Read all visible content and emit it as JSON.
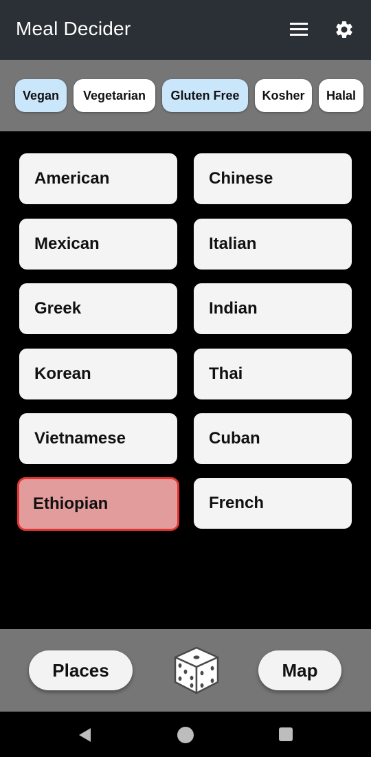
{
  "app": {
    "title": "Meal Decider"
  },
  "filters": [
    {
      "label": "Vegan",
      "selected": true
    },
    {
      "label": "Vegetarian",
      "selected": false
    },
    {
      "label": "Gluten Free",
      "selected": true
    },
    {
      "label": "Kosher",
      "selected": false
    },
    {
      "label": "Halal",
      "selected": false
    }
  ],
  "cuisines": [
    {
      "label": "American",
      "selected": false
    },
    {
      "label": "Chinese",
      "selected": false
    },
    {
      "label": "Mexican",
      "selected": false
    },
    {
      "label": "Italian",
      "selected": false
    },
    {
      "label": "Greek",
      "selected": false
    },
    {
      "label": "Indian",
      "selected": false
    },
    {
      "label": "Korean",
      "selected": false
    },
    {
      "label": "Thai",
      "selected": false
    },
    {
      "label": "Vietnamese",
      "selected": false
    },
    {
      "label": "Cuban",
      "selected": false
    },
    {
      "label": "Ethiopian",
      "selected": true
    },
    {
      "label": "French",
      "selected": false
    }
  ],
  "bottom": {
    "places_label": "Places",
    "map_label": "Map"
  },
  "colors": {
    "appbar": "#2a3036",
    "chip_selected": "#c9e6fb",
    "card_selected_fill": "#e39c9c",
    "card_selected_border": "#e3352f"
  },
  "icons": {
    "menu": "menu-icon",
    "settings": "gear-icon",
    "random": "dice-icon"
  }
}
